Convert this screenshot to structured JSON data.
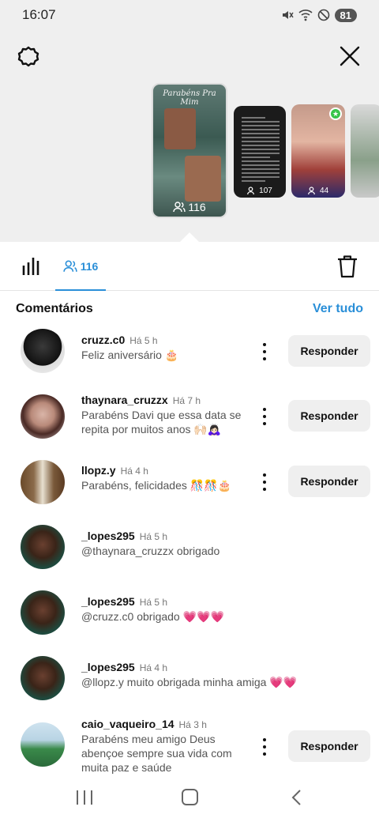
{
  "status_bar": {
    "time": "16:07",
    "battery": "81",
    "icons": [
      "mute-icon",
      "wifi-icon",
      "dnd-icon",
      "battery-icon"
    ]
  },
  "header": {
    "settings_icon": "gear-icon",
    "close_icon": "close-icon"
  },
  "stories": [
    {
      "title": "Parabéns Pra Mim",
      "viewers": "116",
      "selected": true
    },
    {
      "title": "",
      "viewers": "107",
      "selected": false
    },
    {
      "title": "",
      "viewers": "44",
      "selected": false
    },
    {
      "title": "",
      "viewers": "",
      "selected": false
    }
  ],
  "tabs": {
    "stats_icon": "bar-chart-icon",
    "viewers_count": "116",
    "delete_icon": "trash-icon"
  },
  "comments_section": {
    "title": "Comentários",
    "see_all": "Ver tudo",
    "reply_label": "Responder",
    "items": [
      {
        "user": "cruzz.c0",
        "time": "Há 5 h",
        "text": "Feliz aniversário 🎂",
        "has_reply": true
      },
      {
        "user": "thaynara_cruzzx",
        "time": "Há 7 h",
        "text": "Parabéns Davi que essa data se repita por muitos anos 🙌🏻🙇🏻‍♀️",
        "has_reply": true
      },
      {
        "user": "llopz.y",
        "time": "Há 4 h",
        "text": "Parabéns, felicidades 🎊🎊🎂",
        "has_reply": true
      },
      {
        "user": "_lopes295",
        "time": "Há 5 h",
        "text": "@thaynara_cruzzx obrigado",
        "has_reply": false
      },
      {
        "user": "_lopes295",
        "time": "Há 5 h",
        "text": "@cruzz.c0  obrigado 💗💗💗",
        "has_reply": false
      },
      {
        "user": "_lopes295",
        "time": "Há 4 h",
        "text": "@llopz.y muito obrigada minha amiga 💗💗",
        "has_reply": false
      },
      {
        "user": "caio_vaqueiro_14",
        "time": "Há 3 h",
        "text": "Parabéns meu amigo Deus abençoe sempre sua vida com muita paz e saúde",
        "has_reply": true
      }
    ]
  },
  "colors": {
    "accent": "#2a8fd8",
    "top_background": "#efefef",
    "button_background": "#efefef"
  }
}
